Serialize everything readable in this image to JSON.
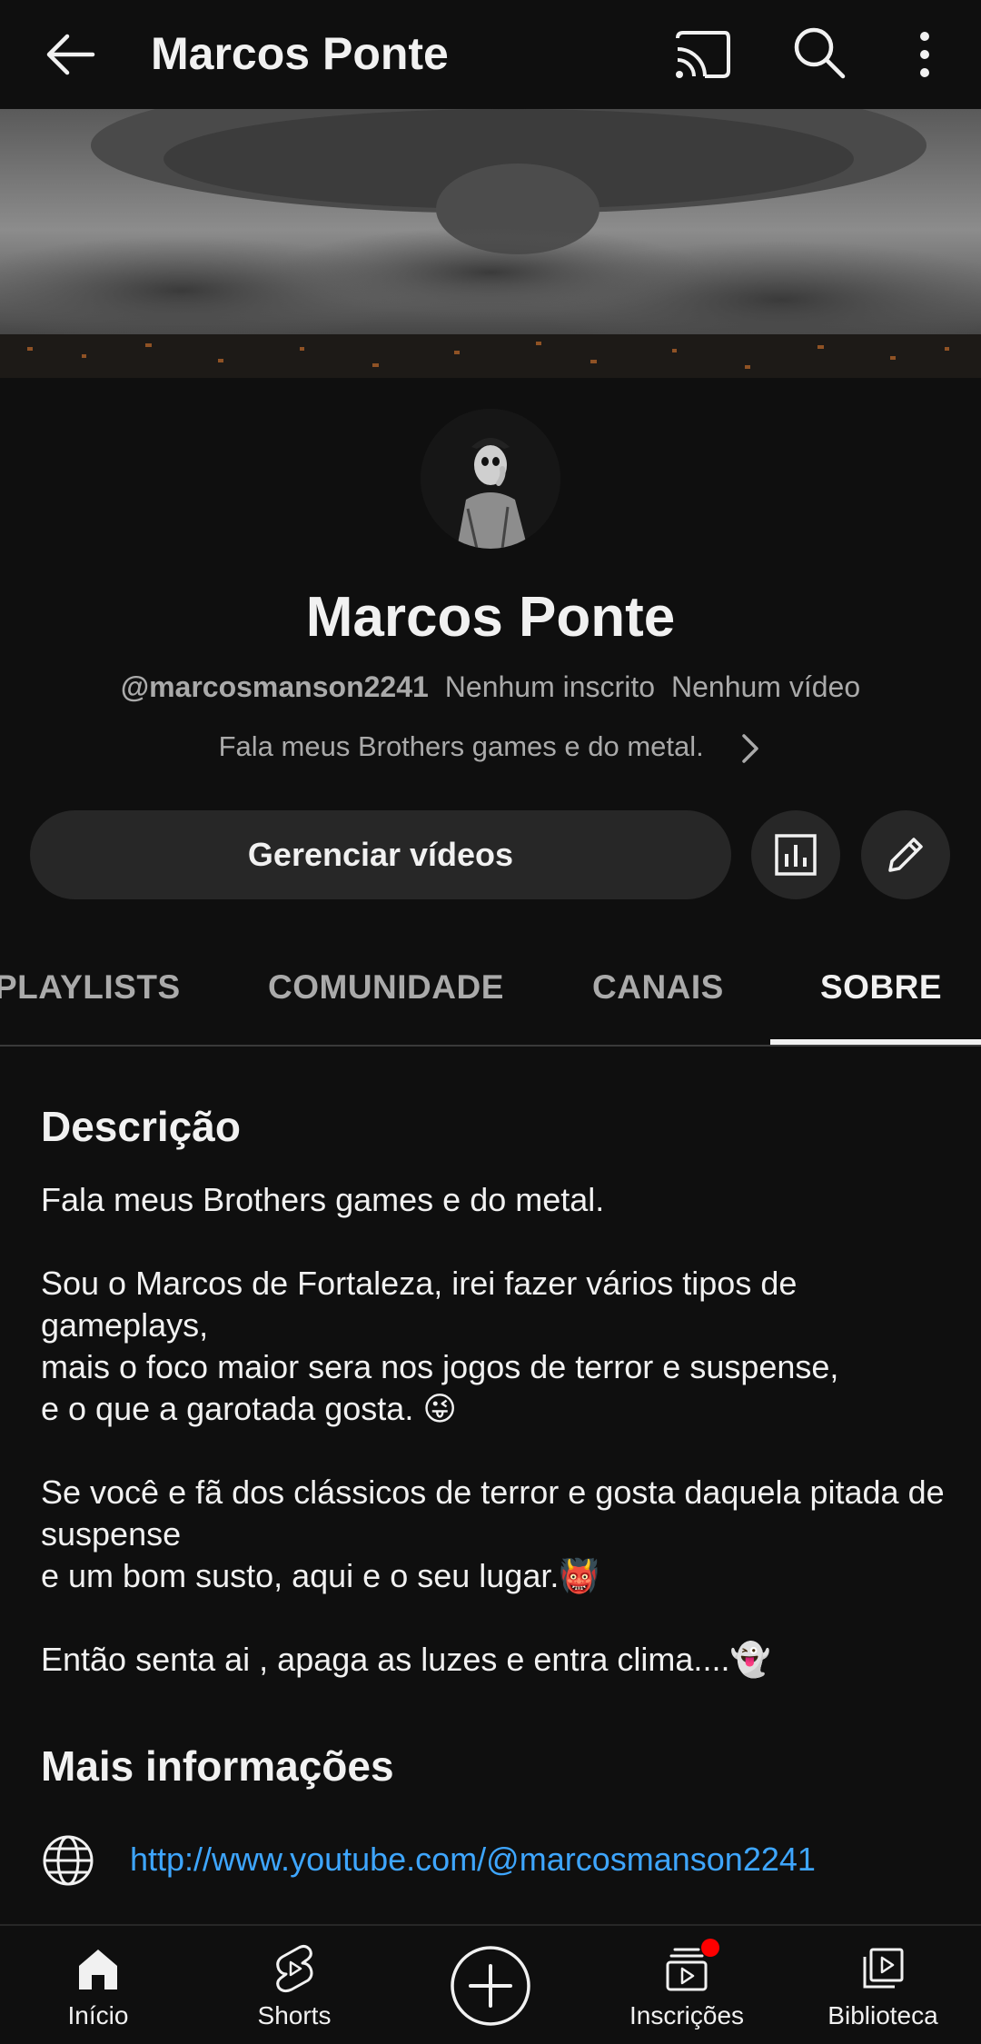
{
  "appbar": {
    "title": "Marcos Ponte",
    "back_icon": "arrow-left-icon",
    "cast_icon": "cast-icon",
    "search_icon": "search-icon",
    "more_icon": "more-vert-icon"
  },
  "channel": {
    "name": "Marcos Ponte",
    "handle": "@marcosmanson2241",
    "subscribers": "Nenhum inscrito",
    "videos": "Nenhum vídeo",
    "short_description": "Fala meus Brothers games e do metal."
  },
  "actions": {
    "manage_label": "Gerenciar vídeos",
    "stats_icon": "analytics-icon",
    "edit_icon": "pencil-icon"
  },
  "tabs": [
    {
      "label": "PLAYLISTS",
      "active": false
    },
    {
      "label": "COMUNIDADE",
      "active": false
    },
    {
      "label": "CANAIS",
      "active": false
    },
    {
      "label": "SOBRE",
      "active": true
    }
  ],
  "about": {
    "description_title": "Descrição",
    "description_lines": [
      "Fala meus Brothers games e do metal.",
      "",
      "Sou o Marcos de Fortaleza, irei fazer vários tipos de gameplays,",
      "mais o foco maior sera nos jogos de terror e suspense,",
      "e o que a garotada gosta. 😜",
      "",
      "Se você e fã dos clássicos de terror e gosta daquela pitada de suspense",
      "e um bom susto, aqui e o seu lugar.👹",
      "",
      "Então senta ai , apaga as luzes e entra clima....👻"
    ],
    "more_info_title": "Mais informações",
    "link": "http://www.youtube.com/@marcosmanson2241"
  },
  "bottom_nav": [
    {
      "label": "Início",
      "icon": "home-icon"
    },
    {
      "label": "Shorts",
      "icon": "shorts-icon"
    },
    {
      "label": "",
      "icon": "create-icon"
    },
    {
      "label": "Inscrições",
      "icon": "subscriptions-icon",
      "has_notification": true
    },
    {
      "label": "Biblioteca",
      "icon": "library-icon"
    }
  ],
  "colors": {
    "background": "#0f0f0f",
    "surface": "#272727",
    "text": "#f1f1f1",
    "secondary_text": "#aaaaaa",
    "link": "#3ea6ff",
    "notification": "#ff0000"
  }
}
